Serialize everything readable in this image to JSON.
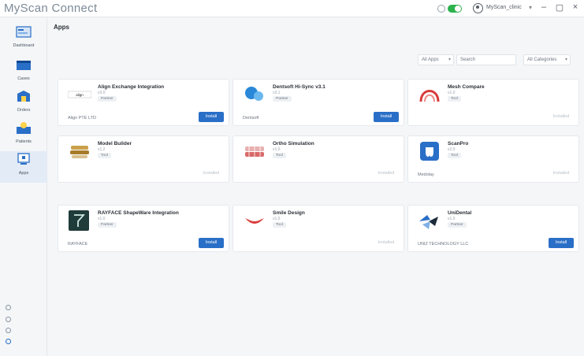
{
  "app": {
    "title": "MyScan Connect",
    "user": "MyScan_clinic",
    "window": {
      "minimize": "–",
      "maximize": "▢",
      "close": "×"
    }
  },
  "sidebar": {
    "items": [
      {
        "label": "Dashboard",
        "icon": "dashboard-icon"
      },
      {
        "label": "Cases",
        "icon": "cases-icon"
      },
      {
        "label": "Orders",
        "icon": "orders-icon"
      },
      {
        "label": "Patients",
        "icon": "patients-icon"
      },
      {
        "label": "Apps",
        "icon": "apps-icon",
        "active": true
      }
    ],
    "footer_icons": [
      "settings-icon",
      "help-icon",
      "info-icon",
      "support-icon"
    ]
  },
  "main": {
    "title": "Apps",
    "filters": {
      "apps": "All Apps",
      "search_placeholder": "Search",
      "categories": "All Categories"
    },
    "apps": [
      {
        "name": "Align Exchange Integration",
        "sub": "v3.0",
        "tag": "Partner",
        "vendor": "Align PTE LTD",
        "action": "Install",
        "logo": "align-logo",
        "accent": "#1d1d1d"
      },
      {
        "name": "Dentsoft Hi-Sync v3.1",
        "sub": "v3.1",
        "tag": "Partner",
        "vendor": "Dentsoft",
        "action": "Install",
        "logo": "dentsoft-logo",
        "accent": "#2a88d8"
      },
      {
        "name": "Mesh Compare",
        "sub": "v1.0",
        "tag": "Tool",
        "vendor": "",
        "action": "Installed",
        "logo": "mesh-compare-logo",
        "accent": "#d83a3a"
      },
      {
        "name": "Model Builder",
        "sub": "v1.2",
        "tag": "Tool",
        "vendor": "",
        "action": "Installed",
        "logo": "model-builder-logo",
        "accent": "#c9a04a"
      },
      {
        "name": "Ortho Simulation",
        "sub": "v1.0",
        "tag": "Tool",
        "vendor": "",
        "action": "Installed",
        "logo": "ortho-simulation-logo",
        "accent": "#d86a6a"
      },
      {
        "name": "ScanPro",
        "sub": "v2.0",
        "tag": "Tool",
        "vendor": "Medolay",
        "action": "Installed",
        "logo": "scanpro-logo",
        "accent": "#2a6fc7"
      },
      {
        "name": "RAYFACE ShapeWare Integration",
        "sub": "v1.0",
        "tag": "Partner",
        "vendor": "RAYFACE",
        "action": "Install",
        "logo": "rayface-logo",
        "accent": "#1f3b3a"
      },
      {
        "name": "Smile Design",
        "sub": "v1.0",
        "tag": "Tool",
        "vendor": "",
        "action": "Installed",
        "logo": "smile-design-logo",
        "accent": "#d83a3a"
      },
      {
        "name": "UniDental",
        "sub": "v1.0",
        "tag": "Partner",
        "vendor": "UNIZ TECHNOLOGY LLC",
        "action": "Install",
        "logo": "unidental-logo",
        "accent": "#2a6fc7"
      }
    ]
  }
}
